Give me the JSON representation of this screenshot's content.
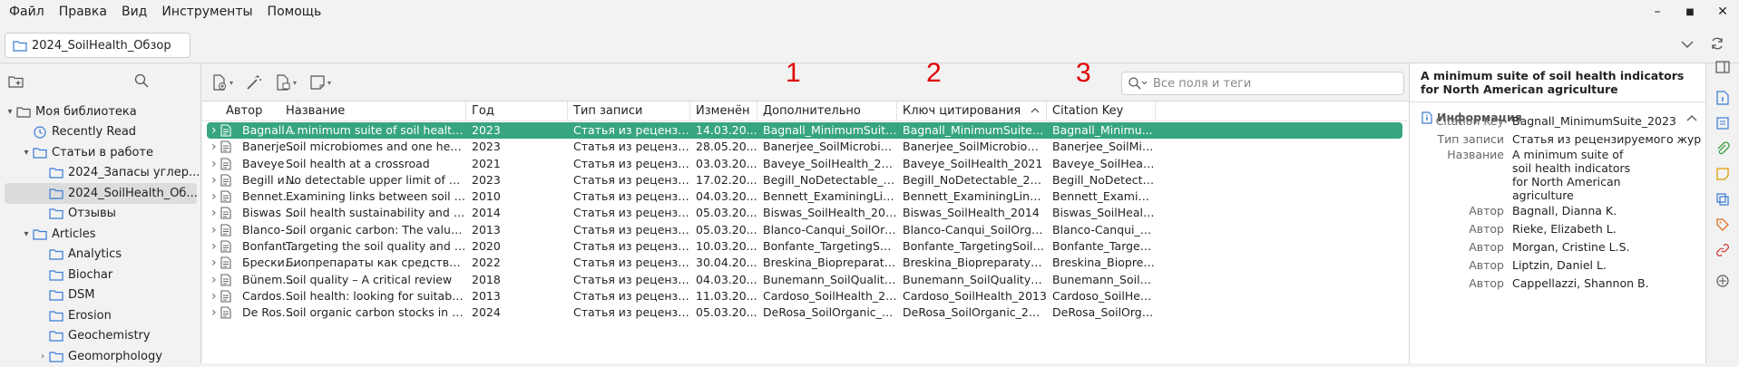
{
  "menu": [
    "Файл",
    "Правка",
    "Вид",
    "Инструменты",
    "Помощь"
  ],
  "window_controls": {
    "minimize": "–",
    "maximize": "■",
    "close": "✕"
  },
  "tab": {
    "label": "2024_SoilHealth_Обзор"
  },
  "collections": [
    {
      "label": "Моя библиотека",
      "level": 0,
      "twisty": "▾",
      "icon": "library-icon"
    },
    {
      "label": "Recently Read",
      "level": 1,
      "twisty": "",
      "icon": "clock-icon"
    },
    {
      "label": "Статьи в работе",
      "level": 1,
      "twisty": "▾",
      "icon": "folder-icon"
    },
    {
      "label": "2024_Запасы углер...",
      "level": 2,
      "twisty": "",
      "icon": "folder-icon"
    },
    {
      "label": "2024_SoilHealth_Об...",
      "level": 2,
      "twisty": "",
      "icon": "folder-icon",
      "selected": true
    },
    {
      "label": "Отзывы",
      "level": 2,
      "twisty": "",
      "icon": "folder-icon"
    },
    {
      "label": "Articles",
      "level": 1,
      "twisty": "▾",
      "icon": "folder-icon"
    },
    {
      "label": "Analytics",
      "level": 2,
      "twisty": "",
      "icon": "folder-icon"
    },
    {
      "label": "Biochar",
      "level": 2,
      "twisty": "",
      "icon": "folder-icon"
    },
    {
      "label": "DSM",
      "level": 2,
      "twisty": "",
      "icon": "folder-icon"
    },
    {
      "label": "Erosion",
      "level": 2,
      "twisty": "",
      "icon": "folder-icon"
    },
    {
      "label": "Geochemistry",
      "level": 2,
      "twisty": "",
      "icon": "folder-icon"
    },
    {
      "label": "Geomorphology",
      "level": 2,
      "twisty": "›",
      "icon": "folder-icon"
    }
  ],
  "search": {
    "placeholder": "Все поля и теги"
  },
  "annotations": [
    "1",
    "2",
    "3"
  ],
  "columns": [
    "Автор",
    "Название",
    "Год",
    "Тип записи",
    "Изменён",
    "Дополнительно",
    "Ключ цитирования",
    "Citation Key"
  ],
  "sort_indicator": "^",
  "rows": [
    [
      "Bagnall и др.",
      "A minimum suite of soil health indic...",
      "2023",
      "Статья из рецензируе...",
      "14.03.20...",
      "Bagnall_MinimumSuite_2...",
      "Bagnall_MinimumSuite_2023",
      "Bagnall_Minimu..."
    ],
    [
      "Banerjee и va...",
      "Soil microbiomes and one health",
      "2023",
      "Статья из рецензируе...",
      "28.05.20...",
      "Banerjee_SoilMicrobiome...",
      "Banerjee_SoilMicrobiome_...",
      "Banerjee_SoilMic..."
    ],
    [
      "Baveye",
      "Soil health at a crossroad",
      "2021",
      "Статья из рецензируе...",
      "03.03.20...",
      "Baveye_SoilHealth_2021",
      "Baveye_SoilHealth_2021",
      "Baveye_SoilHealt..."
    ],
    [
      "Begill и др.",
      "No detectable upper limit of minera...",
      "2023",
      "Статья из рецензируе...",
      "17.02.20...",
      "Begill_NoDetectable_2023",
      "Begill_NoDetectable_2023",
      "Begill_NoDetecta..."
    ],
    [
      "Bennett и др.",
      "Examining links between soil mana...",
      "2010",
      "Статья из рецензируе...",
      "04.03.20...",
      "Bennett_ExaminingLinks_...",
      "Bennett_ExaminingLinks_20...",
      "Bennett_Examini..."
    ],
    [
      "Biswas и др.",
      "Soil health sustainability and organi...",
      "2014",
      "Статья из рецензируе...",
      "05.03.20...",
      "Biswas_SoilHealth_2014",
      "Biswas_SoilHealth_2014",
      "Biswas_SoilHealt..."
    ],
    [
      "Blanco-Canqui...",
      "Soil organic carbon: The value to soi...",
      "2013",
      "Статья из рецензируе...",
      "05.03.20...",
      "Blanco-Canqui_SoilOrgani...",
      "Blanco-Canqui_SoilOrganic_...",
      "Blanco-Canqui_S..."
    ],
    [
      "Bonfante и др.",
      "Targeting the soil quality and soil h...",
      "2020",
      "Статья из рецензируе...",
      "10.03.20...",
      "Bonfante_TargetingSoil_2...",
      "Bonfante_TargetingSoil_2020",
      "Bonfante_Targeti..."
    ],
    [
      "Брескина и др.",
      "Биопрепараты как средство восст...",
      "2022",
      "Статья из рецензируе...",
      "30.04.20...",
      "Breskina_BiopreparatyKa...",
      "Breskina_BiopreparatyKak_...",
      "Breskina_Bioprep..."
    ],
    [
      "Bünemann и ...",
      "Soil quality – A critical review",
      "2018",
      "Статья из рецензируе...",
      "04.03.20...",
      "Bunemann_SoilQuality_20...",
      "Bunemann_SoilQuality_2018",
      "Bunemann_SoilQ..."
    ],
    [
      "Cardoso и др.",
      "Soil health: looking for suitable indi...",
      "2013",
      "Статья из рецензируе...",
      "11.03.20...",
      "Cardoso_SoilHealth_2013",
      "Cardoso_SoilHealth_2013",
      "Cardoso_SoilHeal..."
    ],
    [
      "De Rosa и др.",
      "Soil organic carbon stocks in Europ...",
      "2024",
      "Статья из рецензируе...",
      "05.03.20...",
      "DeRosa_SoilOrganic_2024",
      "DeRosa_SoilOrganic_2024",
      "DeRosa_SoilOrga..."
    ]
  ],
  "item_pane": {
    "title": "A minimum suite of soil health indicators for North American agriculture",
    "section": "Информация",
    "fields": [
      {
        "label": "Citation Key",
        "value": "Bagnall_MinimumSuite_2023"
      },
      {
        "label": "Тип записи",
        "value": "Статья из рецензируемого жур"
      },
      {
        "label": "Название",
        "value": "A minimum suite of soil health indicators for North American agriculture"
      },
      {
        "label": "Автор",
        "value": "Bagnall,  Dianna K."
      },
      {
        "label": "Автор",
        "value": "Rieke,  Elizabeth L."
      },
      {
        "label": "Автор",
        "value": "Morgan,  Cristine L.S."
      },
      {
        "label": "Автор",
        "value": "Liptzin,  Daniel L."
      },
      {
        "label": "Автор",
        "value": "Cappellazzi,  Shannon B."
      }
    ]
  },
  "colors": {
    "accent": "#37a580",
    "annotation": "#dd0000",
    "folder": "#3a7bd5"
  }
}
